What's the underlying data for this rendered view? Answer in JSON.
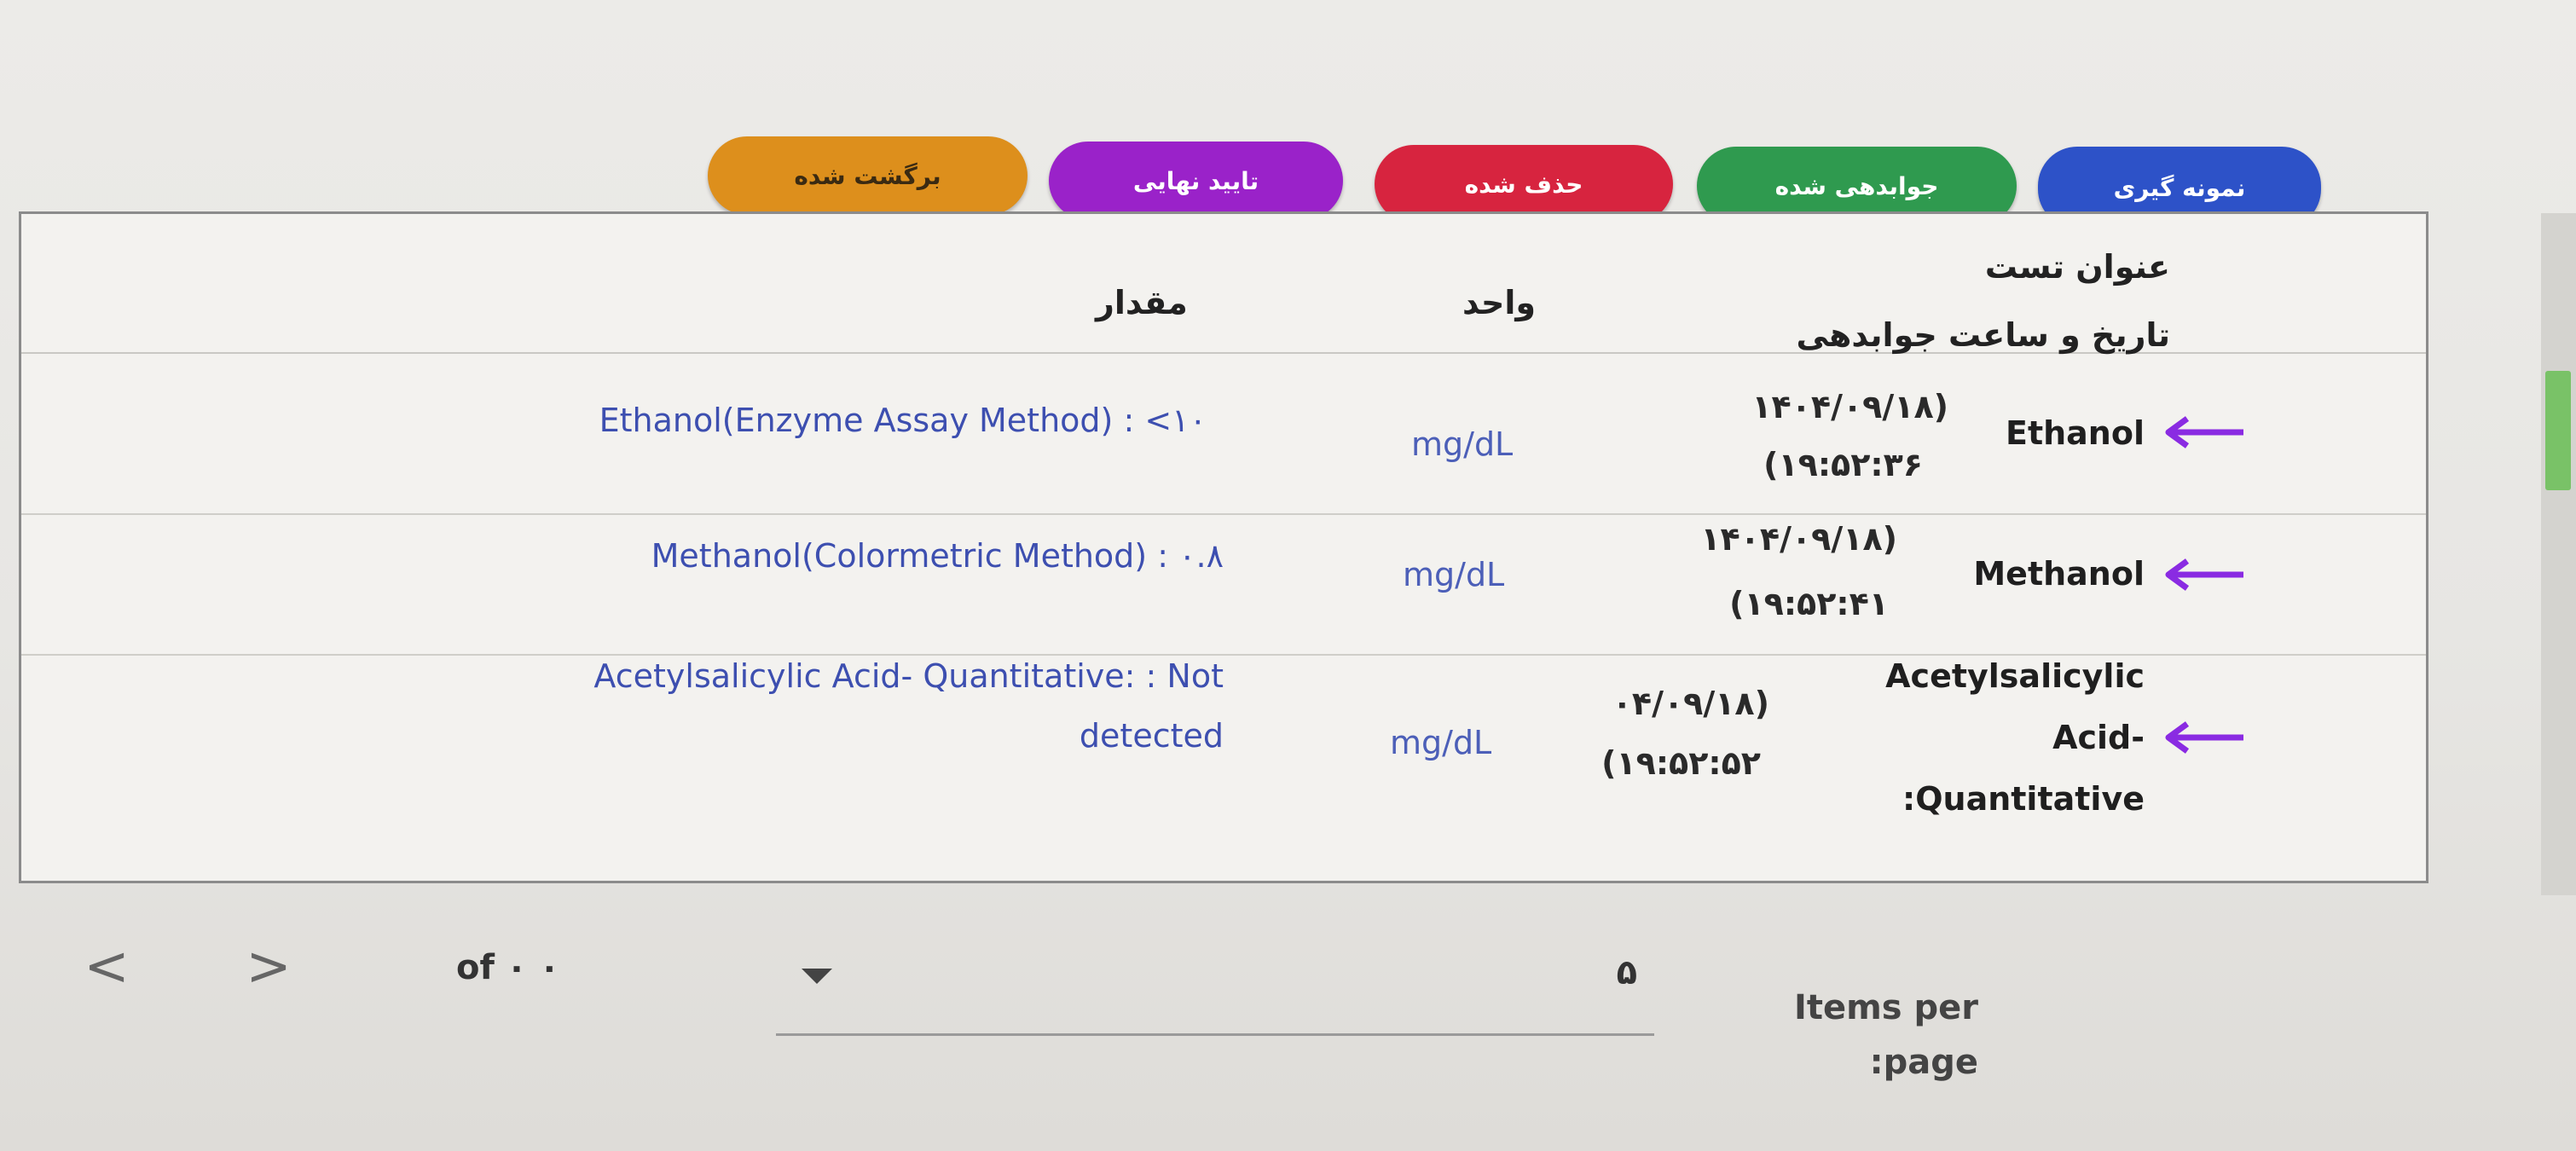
{
  "status_buttons": [
    {
      "label": "برگشت شده",
      "color": "#dd8f1c"
    },
    {
      "label": "تایید نهایی",
      "color": "#9a22c9"
    },
    {
      "label": "حذف شده",
      "color": "#d7243f"
    },
    {
      "label": "جوابدهی شده",
      "color": "#2f9a4f"
    },
    {
      "label": "نمونه گیری",
      "color": "#2d52c8"
    }
  ],
  "table": {
    "headers": {
      "test_title": "عنوان تست",
      "result_datetime": "تاریخ و ساعت جوابدهی",
      "unit": "واحد",
      "value": "مقدار"
    },
    "rows": [
      {
        "test_name": "Ethanol",
        "date": "۱۴۰۴/۰۹/۱۸)",
        "time": "(۱۹:۵۲:۳۶",
        "unit": "mg/dL",
        "value_line1": "Ethanol(Enzyme Assay Method) : <۱۰",
        "value_line2": ""
      },
      {
        "test_name": "Methanol",
        "date": "۱۴۰۴/۰۹/۱۸)",
        "time": "(۱۹:۵۲:۴۱",
        "unit": "mg/dL",
        "value_line1": "Methanol(Colormetric Method) : ۰.۸",
        "value_line2": ""
      },
      {
        "test_name_line1": "Acetylsalicylic",
        "test_name_line2": "Acid-",
        "test_name_line3": ":Quantitative",
        "date": "۰۴/۰۹/۱۸)",
        "time": "(۱۹:۵۲:۵۲",
        "unit": "mg/dL",
        "value_line1": "Acetylsalicylic Acid- Quantitative: : Not",
        "value_line2": "detected"
      }
    ],
    "arrow_color": "#8a2be2"
  },
  "paginator": {
    "prev_icon": "chevron-left-icon",
    "next_icon": "chevron-right-icon",
    "prev_glyph": "<",
    "next_glyph": ">",
    "range_label": "of ۰ ۰",
    "page_size_value": "۵",
    "items_per_page_label_line1": "Items per",
    "items_per_page_label_line2": ":page"
  }
}
